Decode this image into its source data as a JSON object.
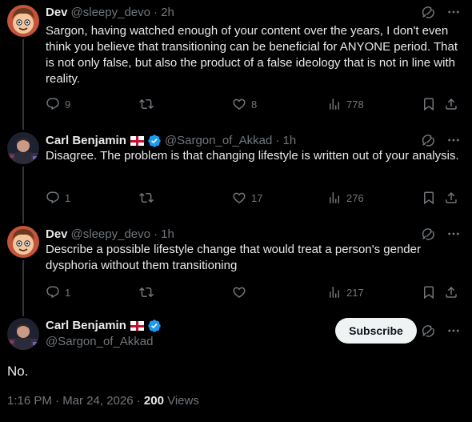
{
  "tweets": [
    {
      "name": "Dev",
      "handle": "@sleepy_devo",
      "time": "· 2h",
      "text": "Sargon, having watched enough of your content over the years, I don't even think you believe that transitioning can be beneficial for ANYONE period. That is not only false, but also the product of a false ideology that is not in line with reality.",
      "replies": "9",
      "reposts": "",
      "likes": "8",
      "views": "778"
    },
    {
      "name": "Carl Benjamin",
      "handle": "@Sargon_of_Akkad",
      "time": "· 1h",
      "text": "Disagree. The problem is that changing lifestyle is written out of your analysis.",
      "replies": "1",
      "reposts": "",
      "likes": "17",
      "views": "276"
    },
    {
      "name": "Dev",
      "handle": "@sleepy_devo",
      "time": "· 1h",
      "text": "Describe a possible lifestyle change that would treat a person's gender dysphoria without them transitioning",
      "replies": "1",
      "reposts": "",
      "likes": "",
      "views": "217"
    }
  ],
  "main_tweet": {
    "name": "Carl Benjamin",
    "handle": "@Sargon_of_Akkad",
    "subscribe_label": "Subscribe",
    "text": "No.",
    "timestamp": "1:16 PM · Mar 24, 2026 · ",
    "views_count": "200",
    "views_label": " Views"
  },
  "colors": {
    "background": "#000000",
    "text": "#e7e9ea",
    "muted": "#71767b",
    "verified": "#1d9bf0"
  },
  "icons": [
    "grok-icon",
    "more-icon",
    "reply-icon",
    "repost-icon",
    "like-icon",
    "views-icon",
    "bookmark-icon",
    "share-icon",
    "verified-icon",
    "flag-england-icon"
  ]
}
